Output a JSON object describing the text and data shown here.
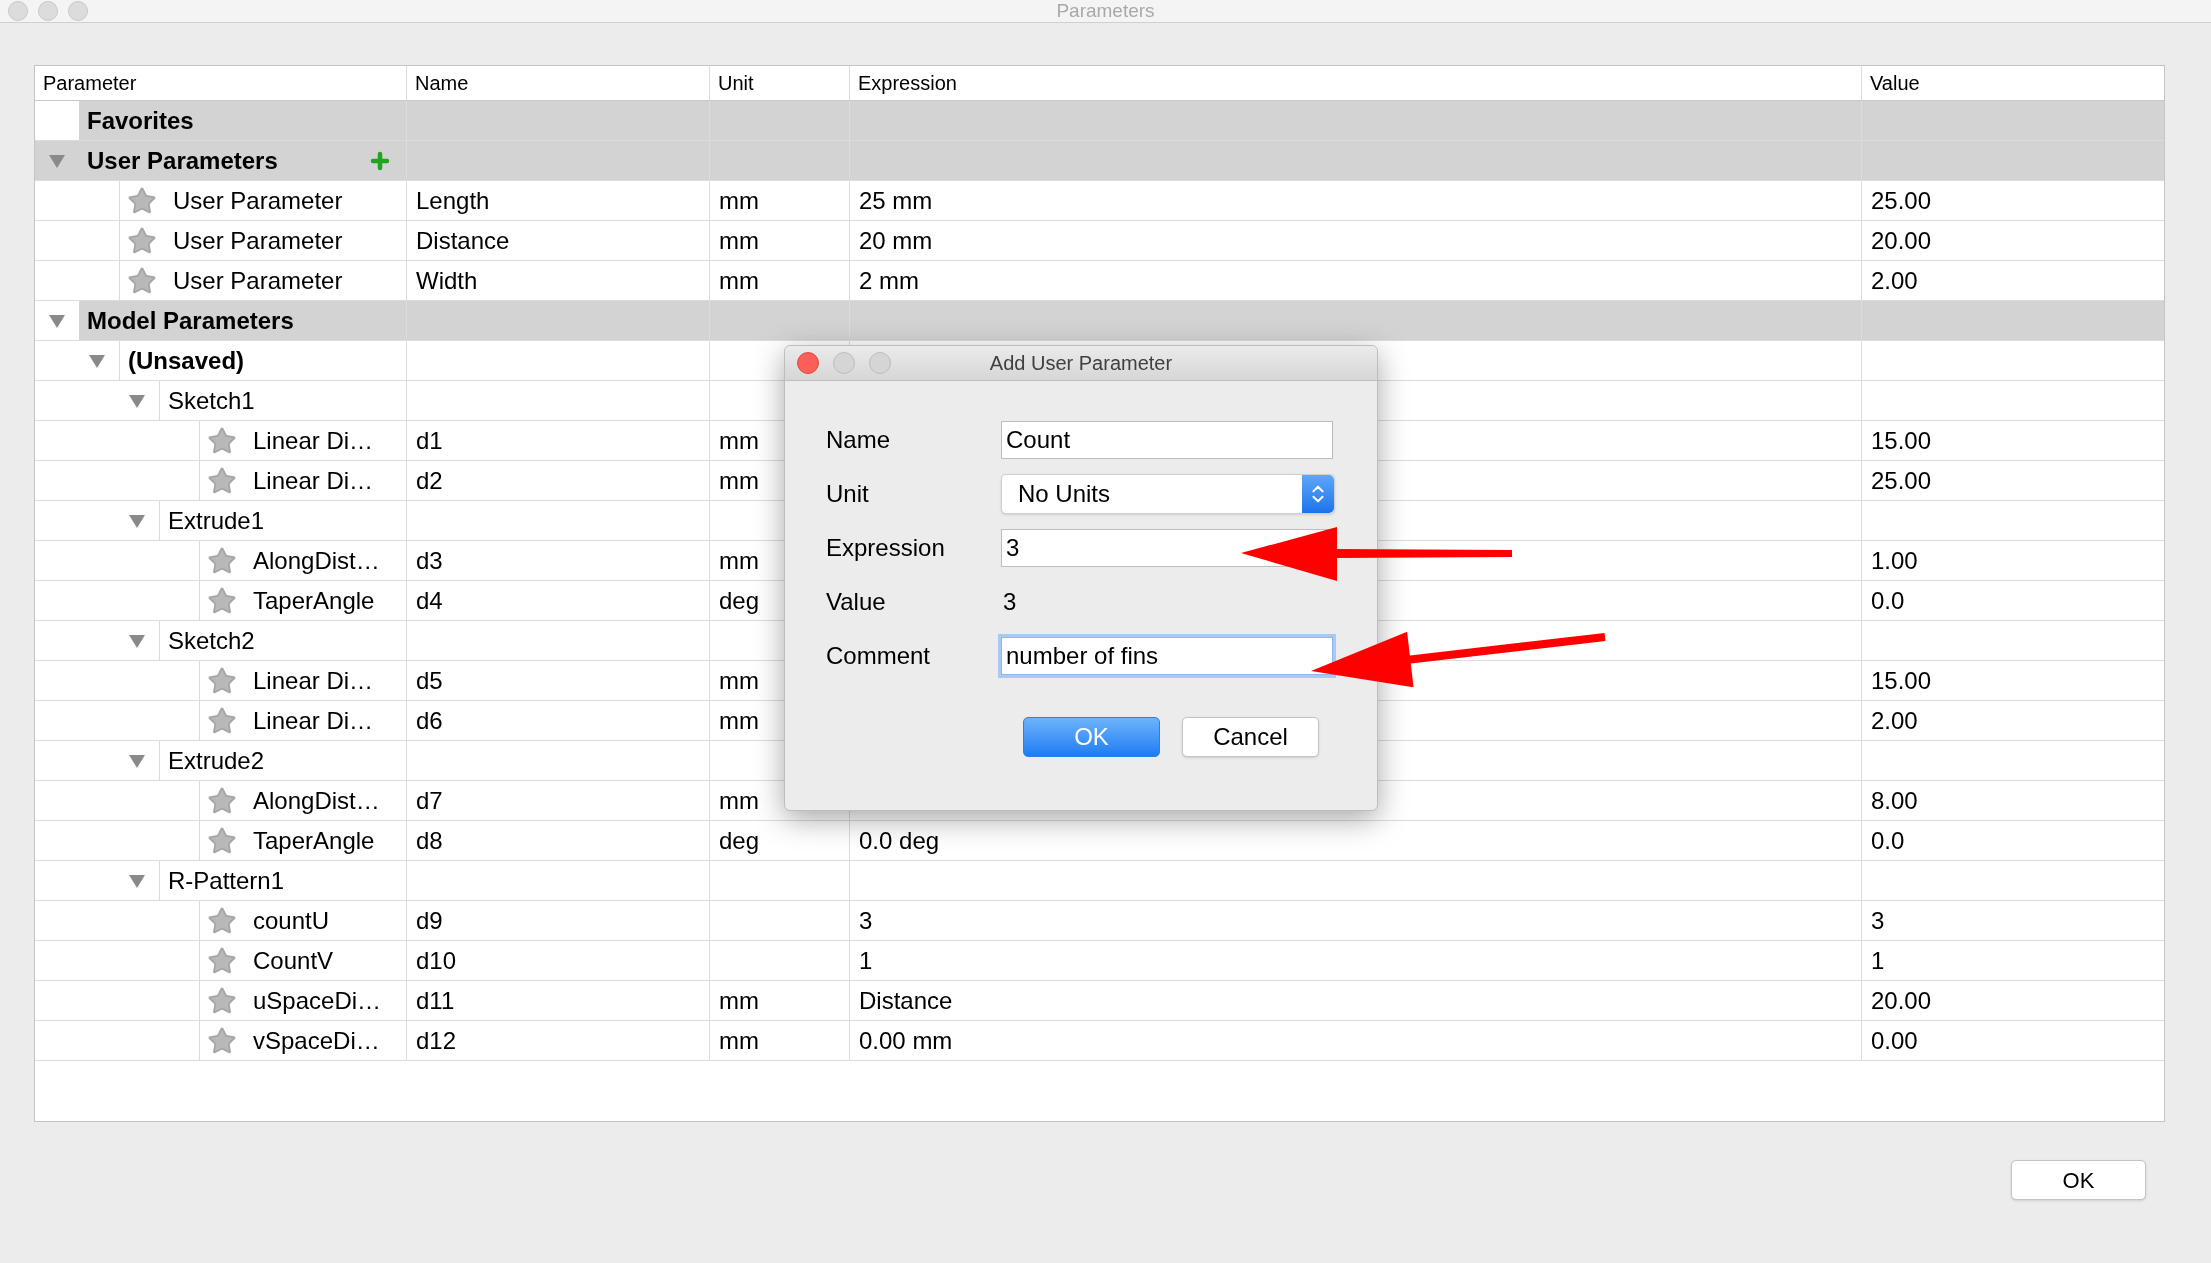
{
  "window": {
    "title": "Parameters"
  },
  "table": {
    "columns": [
      "Parameter",
      "Name",
      "Unit",
      "Expression",
      "Value"
    ],
    "rows": [
      {
        "kind": "group",
        "label": "Favorites",
        "selected": false
      },
      {
        "kind": "group",
        "label": "User Parameters",
        "selected": true,
        "expanded": true,
        "children": [
          {
            "kind": "parameter",
            "label": "User Parameter",
            "name": "Length",
            "unit": "mm",
            "expression": "25 mm",
            "value": "25.00"
          },
          {
            "kind": "parameter",
            "label": "User Parameter",
            "name": "Distance",
            "unit": "mm",
            "expression": "20 mm",
            "value": "20.00"
          },
          {
            "kind": "parameter",
            "label": "User Parameter",
            "name": "Width",
            "unit": "mm",
            "expression": "2 mm",
            "value": "2.00"
          }
        ]
      },
      {
        "kind": "group",
        "label": "Model Parameters",
        "selected": false,
        "expanded": true,
        "children": [
          {
            "kind": "group",
            "label": "(Unsaved)",
            "bold": true,
            "expanded": true,
            "children": [
              {
                "kind": "group",
                "label": "Sketch1",
                "expanded": true,
                "children": [
                  {
                    "kind": "parameter",
                    "label": "Linear Di…",
                    "name": "d1",
                    "unit": "mm",
                    "value": "15.00"
                  },
                  {
                    "kind": "parameter",
                    "label": "Linear Di…",
                    "name": "d2",
                    "unit": "mm",
                    "value": "25.00"
                  }
                ]
              },
              {
                "kind": "group",
                "label": "Extrude1",
                "expanded": true,
                "children": [
                  {
                    "kind": "parameter",
                    "label": "AlongDist…",
                    "name": "d3",
                    "unit": "mm",
                    "value": "1.00"
                  },
                  {
                    "kind": "parameter",
                    "label": "TaperAngle",
                    "name": "d4",
                    "unit": "deg",
                    "value": "0.0"
                  }
                ]
              },
              {
                "kind": "group",
                "label": "Sketch2",
                "expanded": true,
                "children": [
                  {
                    "kind": "parameter",
                    "label": "Linear Di…",
                    "name": "d5",
                    "unit": "mm",
                    "value": "15.00"
                  },
                  {
                    "kind": "parameter",
                    "label": "Linear Di…",
                    "name": "d6",
                    "unit": "mm",
                    "value": "2.00"
                  }
                ]
              },
              {
                "kind": "group",
                "label": "Extrude2",
                "expanded": true,
                "children": [
                  {
                    "kind": "parameter",
                    "label": "AlongDist…",
                    "name": "d7",
                    "unit": "mm",
                    "value": "8.00"
                  },
                  {
                    "kind": "parameter",
                    "label": "TaperAngle",
                    "name": "d8",
                    "unit": "deg",
                    "expression": "0.0 deg",
                    "value": "0.0"
                  }
                ]
              },
              {
                "kind": "group",
                "label": "R-Pattern1",
                "expanded": true,
                "children": [
                  {
                    "kind": "parameter",
                    "label": "countU",
                    "name": "d9",
                    "expression": "3",
                    "value": "3"
                  },
                  {
                    "kind": "parameter",
                    "label": "CountV",
                    "name": "d10",
                    "expression": "1",
                    "value": "1"
                  },
                  {
                    "kind": "parameter",
                    "label": "uSpaceDi…",
                    "name": "d11",
                    "unit": "mm",
                    "expression": "Distance",
                    "value": "20.00"
                  },
                  {
                    "kind": "parameter",
                    "label": "vSpaceDi…",
                    "name": "d12",
                    "unit": "mm",
                    "expression": "0.00 mm",
                    "value": "0.00"
                  }
                ]
              }
            ]
          }
        ]
      }
    ]
  },
  "dialog": {
    "title": "Add User Parameter",
    "fields": [
      {
        "kind": "text",
        "label": "Name",
        "value": "Count",
        "focused": false
      },
      {
        "kind": "select",
        "label": "Unit",
        "value": "No Units"
      },
      {
        "kind": "text",
        "label": "Expression",
        "value": "3",
        "focused": false
      },
      {
        "kind": "readout",
        "label": "Value",
        "value": "3"
      },
      {
        "kind": "text",
        "label": "Comment",
        "value": "number of fins",
        "focused": true
      }
    ],
    "buttons": [
      {
        "label": "OK",
        "default": true
      },
      {
        "label": "Cancel",
        "default": false
      }
    ]
  },
  "ok_button": "OK"
}
